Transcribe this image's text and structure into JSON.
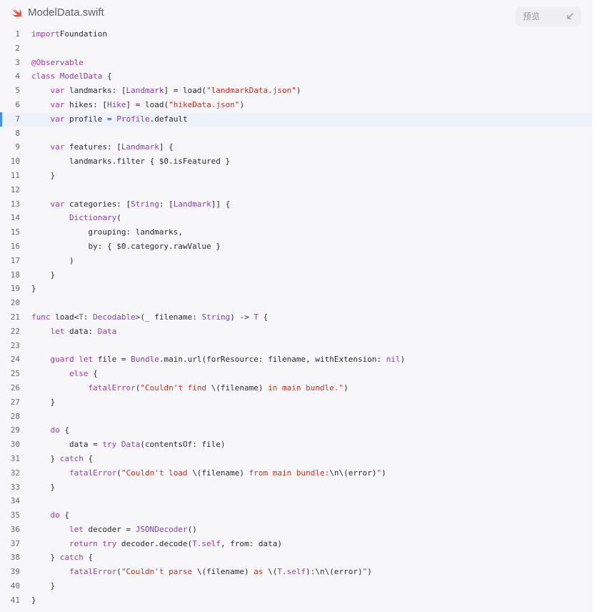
{
  "header": {
    "file_name": "ModelData.swift",
    "file_icon": "swift-logo-icon",
    "preview_label": "预览",
    "collapse_icon": "collapse-arrow-icon"
  },
  "colors": {
    "keyword": "#a03aa0",
    "type": "#8540b0",
    "string": "#c6321f",
    "plain": "#2b2b2b",
    "active_marker": "#4a90e2",
    "swift_orange": "#f05138"
  },
  "active_line": 7,
  "code_lines": [
    {
      "n": "1",
      "tokens": [
        [
          "kw",
          "import"
        ],
        [
          "",
          "Foundation"
        ]
      ]
    },
    {
      "n": "2",
      "tokens": []
    },
    {
      "n": "3",
      "tokens": [
        [
          "kw",
          "@Observable"
        ]
      ]
    },
    {
      "n": "4",
      "tokens": [
        [
          "kw",
          "class"
        ],
        [
          "",
          " "
        ],
        [
          "ty",
          "ModelData"
        ],
        [
          "",
          " {"
        ]
      ]
    },
    {
      "n": "5",
      "tokens": [
        [
          "",
          "    "
        ],
        [
          "kw",
          "var"
        ],
        [
          "",
          " landmarks: ["
        ],
        [
          "ty",
          "Landmark"
        ],
        [
          "",
          "] = load("
        ],
        [
          "st",
          "\"landmarkData.json\""
        ],
        [
          "",
          ")"
        ]
      ]
    },
    {
      "n": "6",
      "tokens": [
        [
          "",
          "    "
        ],
        [
          "kw",
          "var"
        ],
        [
          "",
          " hikes: ["
        ],
        [
          "ty",
          "Hike"
        ],
        [
          "",
          "] = load("
        ],
        [
          "st",
          "\"hikeData.json\""
        ],
        [
          "",
          ")"
        ]
      ]
    },
    {
      "n": "7",
      "tokens": [
        [
          "",
          "    "
        ],
        [
          "kw",
          "var"
        ],
        [
          "",
          " profile = "
        ],
        [
          "ty",
          "Profile"
        ],
        [
          "",
          ".default"
        ]
      ]
    },
    {
      "n": "8",
      "tokens": []
    },
    {
      "n": "9",
      "tokens": [
        [
          "",
          "    "
        ],
        [
          "kw",
          "var"
        ],
        [
          "",
          " features: ["
        ],
        [
          "ty",
          "Landmark"
        ],
        [
          "",
          "] {"
        ]
      ]
    },
    {
      "n": "10",
      "tokens": [
        [
          "",
          "        landmarks.filter { $0.isFeatured }"
        ]
      ]
    },
    {
      "n": "11",
      "tokens": [
        [
          "",
          "    }"
        ]
      ]
    },
    {
      "n": "12",
      "tokens": []
    },
    {
      "n": "13",
      "tokens": [
        [
          "",
          "    "
        ],
        [
          "kw",
          "var"
        ],
        [
          "",
          " categories: ["
        ],
        [
          "ty",
          "String"
        ],
        [
          "",
          ": ["
        ],
        [
          "ty",
          "Landmark"
        ],
        [
          "",
          "]] {"
        ]
      ]
    },
    {
      "n": "14",
      "tokens": [
        [
          "",
          "        "
        ],
        [
          "ty",
          "Dictionary"
        ],
        [
          "",
          "("
        ]
      ]
    },
    {
      "n": "15",
      "tokens": [
        [
          "",
          "            grouping: landmarks,"
        ]
      ]
    },
    {
      "n": "16",
      "tokens": [
        [
          "",
          "            by: { $0.category.rawValue }"
        ]
      ]
    },
    {
      "n": "17",
      "tokens": [
        [
          "",
          "        )"
        ]
      ]
    },
    {
      "n": "18",
      "tokens": [
        [
          "",
          "    }"
        ]
      ]
    },
    {
      "n": "19",
      "tokens": [
        [
          "",
          "}"
        ]
      ]
    },
    {
      "n": "20",
      "tokens": []
    },
    {
      "n": "21",
      "tokens": [
        [
          "kw",
          "func"
        ],
        [
          "",
          " load<"
        ],
        [
          "ty",
          "T"
        ],
        [
          "",
          ": "
        ],
        [
          "ty",
          "Decodable"
        ],
        [
          "",
          ">(_ filename: "
        ],
        [
          "ty",
          "String"
        ],
        [
          "",
          ") -> "
        ],
        [
          "ty",
          "T"
        ],
        [
          "",
          " {"
        ]
      ]
    },
    {
      "n": "22",
      "tokens": [
        [
          "",
          "    "
        ],
        [
          "kw",
          "let"
        ],
        [
          "",
          " data: "
        ],
        [
          "ty",
          "Data"
        ]
      ]
    },
    {
      "n": "23",
      "tokens": []
    },
    {
      "n": "24",
      "tokens": [
        [
          "",
          "    "
        ],
        [
          "kw",
          "guard let"
        ],
        [
          "",
          " file = "
        ],
        [
          "ty",
          "Bundle"
        ],
        [
          "",
          ".main.url(forResource: filename, withExtension: "
        ],
        [
          "kw",
          "nil"
        ],
        [
          "",
          ")"
        ]
      ]
    },
    {
      "n": "25",
      "tokens": [
        [
          "",
          "        "
        ],
        [
          "kw",
          "else"
        ],
        [
          "",
          " {"
        ]
      ]
    },
    {
      "n": "26",
      "tokens": [
        [
          "",
          "            "
        ],
        [
          "fn",
          "fatalError"
        ],
        [
          "",
          "("
        ],
        [
          "st",
          "\"Couldn't find "
        ],
        [
          "",
          "\\(filename)"
        ],
        [
          "st",
          " in main bundle.\""
        ],
        [
          "",
          ")"
        ]
      ]
    },
    {
      "n": "27",
      "tokens": [
        [
          "",
          "    }"
        ]
      ]
    },
    {
      "n": "28",
      "tokens": []
    },
    {
      "n": "29",
      "tokens": [
        [
          "",
          "    "
        ],
        [
          "kw",
          "do"
        ],
        [
          "",
          " {"
        ]
      ]
    },
    {
      "n": "30",
      "tokens": [
        [
          "",
          "        data = "
        ],
        [
          "kw",
          "try"
        ],
        [
          "",
          " "
        ],
        [
          "ty",
          "Data"
        ],
        [
          "",
          "(contentsOf: file)"
        ]
      ]
    },
    {
      "n": "31",
      "tokens": [
        [
          "",
          "    } "
        ],
        [
          "kw",
          "catch"
        ],
        [
          "",
          " {"
        ]
      ]
    },
    {
      "n": "32",
      "tokens": [
        [
          "",
          "        "
        ],
        [
          "fn",
          "fatalError"
        ],
        [
          "",
          "("
        ],
        [
          "st",
          "\"Couldn't load "
        ],
        [
          "",
          "\\(filename)"
        ],
        [
          "st",
          " from main bundle:"
        ],
        [
          "",
          "\\n\\(error)"
        ],
        [
          "st",
          "\""
        ],
        [
          "",
          ")"
        ]
      ]
    },
    {
      "n": "33",
      "tokens": [
        [
          "",
          "    }"
        ]
      ]
    },
    {
      "n": "34",
      "tokens": []
    },
    {
      "n": "35",
      "tokens": [
        [
          "",
          "    "
        ],
        [
          "kw",
          "do"
        ],
        [
          "",
          " {"
        ]
      ]
    },
    {
      "n": "36",
      "tokens": [
        [
          "",
          "        "
        ],
        [
          "kw",
          "let"
        ],
        [
          "",
          " decoder = "
        ],
        [
          "ty",
          "JSONDecoder"
        ],
        [
          "",
          "()"
        ]
      ]
    },
    {
      "n": "37",
      "tokens": [
        [
          "",
          "        "
        ],
        [
          "kw",
          "return try"
        ],
        [
          "",
          " decoder.decode("
        ],
        [
          "ty",
          "T"
        ],
        [
          "kw",
          ".self"
        ],
        [
          "",
          ", from: data)"
        ]
      ]
    },
    {
      "n": "38",
      "tokens": [
        [
          "",
          "    } "
        ],
        [
          "kw",
          "catch"
        ],
        [
          "",
          " {"
        ]
      ]
    },
    {
      "n": "39",
      "tokens": [
        [
          "",
          "        "
        ],
        [
          "fn",
          "fatalError"
        ],
        [
          "",
          "("
        ],
        [
          "st",
          "\"Couldn't parse "
        ],
        [
          "",
          "\\(filename)"
        ],
        [
          "st",
          " as "
        ],
        [
          "",
          "\\("
        ],
        [
          "ty",
          "T"
        ],
        [
          "kw",
          ".self"
        ],
        [
          "",
          "):\\n\\(error)"
        ],
        [
          "st",
          "\""
        ],
        [
          "",
          ")"
        ]
      ]
    },
    {
      "n": "40",
      "tokens": [
        [
          "",
          "    }"
        ]
      ]
    },
    {
      "n": "41",
      "tokens": [
        [
          "",
          "}"
        ]
      ]
    }
  ]
}
